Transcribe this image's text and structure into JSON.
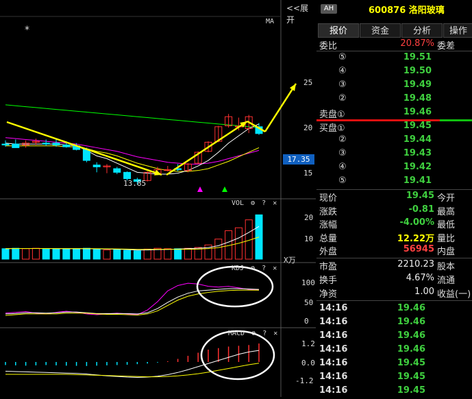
{
  "chart_header": {
    "expand_label": "<<展开",
    "ma_label": "MA",
    "vol_label": "VOL",
    "kdj_label": "KDJ",
    "macd_label": "MACD",
    "volume_unit": "X万",
    "low_price_label": "13.85",
    "star_label": "*",
    "current_price_tag": "17.35",
    "gear": "⚙",
    "question": "?",
    "close": "✕"
  },
  "axes": {
    "price_ticks": [
      "25",
      "20",
      "15"
    ],
    "vol_ticks": [
      "20",
      "10"
    ],
    "kdj_ticks": [
      "100",
      "50",
      "0"
    ],
    "macd_ticks": [
      "1.2",
      "0.0",
      "-1.2"
    ]
  },
  "stock": {
    "badge": "AH",
    "code_name": "600876 洛阳玻璃"
  },
  "tabs": [
    "报价",
    "资金",
    "分析",
    "操作"
  ],
  "order_book": {
    "ratio_label": "委比",
    "ratio_value": "20.87%",
    "diff_label": "委差",
    "sell": [
      {
        "num": "⑤",
        "price": "19.51"
      },
      {
        "num": "④",
        "price": "19.50"
      },
      {
        "num": "③",
        "price": "19.49"
      },
      {
        "num": "②",
        "price": "19.48"
      },
      {
        "num": "卖盘①",
        "price": "19.46"
      }
    ],
    "buy": [
      {
        "num": "买盘①",
        "price": "19.45"
      },
      {
        "num": "②",
        "price": "19.44"
      },
      {
        "num": "③",
        "price": "19.43"
      },
      {
        "num": "④",
        "price": "19.42"
      },
      {
        "num": "⑤",
        "price": "19.41"
      }
    ]
  },
  "quote": [
    {
      "l1": "现价",
      "v": "19.45",
      "l2": "今开",
      "color": "#3fcf3f"
    },
    {
      "l1": "涨跌",
      "v": "-0.81",
      "l2": "最高",
      "color": "#3fcf3f"
    },
    {
      "l1": "涨幅",
      "v": "-4.00%",
      "l2": "最低",
      "color": "#3fcf3f"
    },
    {
      "l1": "总量",
      "v": "12.22万",
      "l2": "量比",
      "color": "#ffff00"
    },
    {
      "l1": "外盘",
      "v": "56945",
      "l2": "内盘",
      "color": "#ff4040"
    }
  ],
  "stats": [
    {
      "l1": "市盈",
      "v": "2210.23",
      "l2": "股本"
    },
    {
      "l1": "换手",
      "v": "4.67%",
      "l2": "流通"
    },
    {
      "l1": "净资",
      "v": "1.00",
      "l2": "收益(一)"
    }
  ],
  "ticks": [
    {
      "time": "14:16",
      "price": "19.46"
    },
    {
      "time": "14:16",
      "price": "19.46"
    },
    {
      "time": "14:16",
      "price": "19.46"
    },
    {
      "time": "14:16",
      "price": "19.46"
    },
    {
      "time": "14:16",
      "price": "19.45"
    },
    {
      "time": "14:16",
      "price": "19.45"
    },
    {
      "time": "14:16",
      "price": "19.45"
    }
  ],
  "colors": {
    "up": "#ff3030",
    "down": "#00e5ff",
    "ma5": "#ffffff",
    "ma10": "#ffff00",
    "ma20": "#ff00ff",
    "ma60": "#00ff00",
    "annotation": "#ffff00"
  },
  "chart_data": {
    "type": "candlestick",
    "price_axis": [
      25,
      20,
      15
    ],
    "candles": [
      {
        "o": 18.3,
        "h": 18.7,
        "l": 18.0,
        "c": 18.2
      },
      {
        "o": 18.3,
        "h": 18.8,
        "l": 18.0,
        "c": 17.9
      },
      {
        "o": 18.2,
        "h": 18.7,
        "l": 17.9,
        "c": 18.4
      },
      {
        "o": 18.5,
        "h": 18.9,
        "l": 18.2,
        "c": 18.6
      },
      {
        "o": 18.4,
        "h": 18.8,
        "l": 18.1,
        "c": 18.3
      },
      {
        "o": 18.4,
        "h": 18.8,
        "l": 18.0,
        "c": 18.2
      },
      {
        "o": 18.2,
        "h": 18.6,
        "l": 17.9,
        "c": 18.0
      },
      {
        "o": 18.1,
        "h": 18.4,
        "l": 17.6,
        "c": 17.7
      },
      {
        "o": 17.7,
        "h": 17.9,
        "l": 16.3,
        "c": 16.5
      },
      {
        "o": 16.0,
        "h": 16.3,
        "l": 15.2,
        "c": 15.8
      },
      {
        "o": 15.8,
        "h": 16.1,
        "l": 15.1,
        "c": 15.9
      },
      {
        "o": 15.6,
        "h": 15.8,
        "l": 15.0,
        "c": 15.2
      },
      {
        "o": 15.2,
        "h": 15.3,
        "l": 14.3,
        "c": 14.5
      },
      {
        "o": 14.4,
        "h": 14.6,
        "l": 13.85,
        "c": 14.2
      },
      {
        "o": 14.3,
        "h": 15.3,
        "l": 14.2,
        "c": 15.2
      },
      {
        "o": 15.1,
        "h": 15.8,
        "l": 14.9,
        "c": 15.5
      },
      {
        "o": 15.4,
        "h": 15.9,
        "l": 15.3,
        "c": 15.5
      },
      {
        "o": 15.6,
        "h": 16.1,
        "l": 15.3,
        "c": 15.5
      },
      {
        "o": 15.4,
        "h": 16.2,
        "l": 15.2,
        "c": 16.1
      },
      {
        "o": 16.2,
        "h": 17.5,
        "l": 16.1,
        "c": 17.4
      },
      {
        "o": 17.5,
        "h": 18.6,
        "l": 17.4,
        "c": 18.5
      },
      {
        "o": 18.6,
        "h": 20.3,
        "l": 18.5,
        "c": 20.2
      },
      {
        "o": 20.3,
        "h": 21.6,
        "l": 20.1,
        "c": 21.3
      },
      {
        "o": 20.2,
        "h": 21.2,
        "l": 19.8,
        "c": 20.26
      },
      {
        "o": 20.0,
        "h": 21.5,
        "l": 19.5,
        "c": 21.3
      },
      {
        "o": 20.2,
        "h": 20.6,
        "l": 19.3,
        "c": 19.45
      }
    ],
    "ma5": [
      18.4,
      18.3,
      18.3,
      18.3,
      18.3,
      18.3,
      18.2,
      18.1,
      17.6,
      17.0,
      16.7,
      16.2,
      15.7,
      15.2,
      15.1,
      15.0,
      15.0,
      15.1,
      15.4,
      15.9,
      16.5,
      17.4,
      18.4,
      19.2,
      20.0,
      20.5
    ],
    "ma10": [
      18.1,
      18.1,
      18.1,
      18.1,
      18.1,
      18.1,
      18.0,
      18.0,
      17.8,
      17.5,
      17.3,
      17.0,
      16.6,
      16.2,
      15.9,
      15.6,
      15.4,
      15.3,
      15.3,
      15.4,
      15.6,
      16.0,
      16.4,
      16.9,
      17.4,
      17.9
    ],
    "ma20": [
      19.0,
      18.9,
      18.8,
      18.7,
      18.6,
      18.5,
      18.4,
      18.3,
      18.1,
      17.9,
      17.7,
      17.5,
      17.2,
      16.9,
      16.7,
      16.5,
      16.3,
      16.2,
      16.1,
      16.1,
      16.2,
      16.4,
      16.7,
      17.0,
      17.3,
      17.6
    ],
    "ma60": [
      22.6,
      22.5,
      22.4,
      22.3,
      22.2,
      22.1,
      22.0,
      21.9,
      21.8,
      21.7,
      21.6,
      21.5,
      21.4,
      21.3,
      21.2,
      21.1,
      21.0,
      20.9,
      20.8,
      20.7,
      20.6,
      20.5,
      20.4,
      20.3,
      20.2,
      20.1
    ],
    "volume": {
      "axis": [
        20,
        10
      ],
      "values": [
        2.5,
        2.6,
        2.5,
        2.6,
        2.5,
        2.4,
        2.5,
        2.5,
        2.6,
        2.3,
        2.2,
        2.3,
        2.1,
        2.0,
        2.4,
        2.6,
        2.5,
        2.5,
        2.6,
        2.8,
        3.4,
        4.8,
        6.8,
        7.5,
        9.4,
        10.6
      ]
    },
    "kdj": {
      "axis": [
        100,
        50,
        0
      ],
      "k": [
        20,
        22,
        24,
        20,
        18,
        22,
        25,
        22,
        18,
        16,
        18,
        20,
        18,
        16,
        28,
        50,
        78,
        92,
        98,
        96,
        90,
        88,
        90,
        86,
        82,
        80
      ],
      "d": [
        18,
        19,
        21,
        21,
        20,
        21,
        23,
        23,
        21,
        19,
        19,
        19,
        19,
        18,
        21,
        32,
        48,
        62,
        72,
        78,
        80,
        82,
        84,
        84,
        83,
        82
      ],
      "j": [
        14,
        16,
        18,
        18,
        18,
        18,
        20,
        20,
        20,
        18,
        17,
        17,
        16,
        15,
        18,
        26,
        40,
        54,
        64,
        70,
        74,
        77,
        79,
        80,
        80,
        80
      ]
    },
    "macd": {
      "axis": [
        1.2,
        0.0,
        -1.2
      ],
      "hist": [
        -0.2,
        -0.22,
        -0.24,
        -0.22,
        -0.2,
        -0.22,
        -0.24,
        -0.25,
        -0.26,
        -0.24,
        -0.22,
        -0.2,
        -0.18,
        -0.14,
        -0.1,
        -0.04,
        0.05,
        0.2,
        0.4,
        0.6,
        0.8,
        0.9,
        1.0,
        1.05,
        1.1,
        1.2
      ],
      "dif": [
        -0.6,
        -0.62,
        -0.64,
        -0.66,
        -0.68,
        -0.7,
        -0.72,
        -0.74,
        -0.78,
        -0.84,
        -0.9,
        -0.94,
        -0.98,
        -1.0,
        -0.98,
        -0.92,
        -0.82,
        -0.68,
        -0.5,
        -0.3,
        -0.1,
        0.1,
        0.3,
        0.5,
        0.65,
        0.75
      ],
      "dea": [
        -0.8,
        -0.8,
        -0.8,
        -0.8,
        -0.8,
        -0.8,
        -0.8,
        -0.82,
        -0.84,
        -0.86,
        -0.88,
        -0.9,
        -0.92,
        -0.94,
        -0.96,
        -0.96,
        -0.94,
        -0.9,
        -0.84,
        -0.76,
        -0.66,
        -0.54,
        -0.42,
        -0.3,
        -0.18,
        -0.08
      ]
    }
  }
}
